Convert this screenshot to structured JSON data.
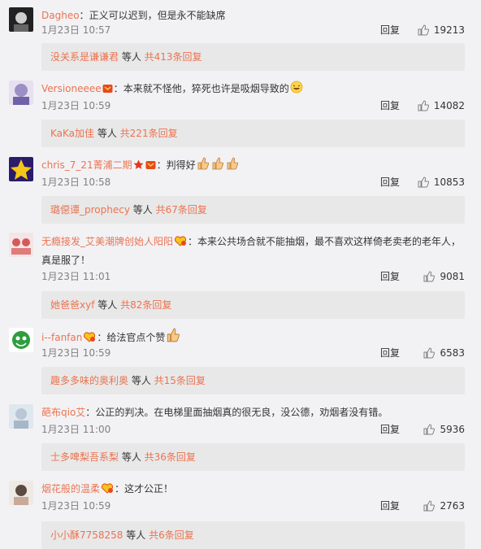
{
  "colors": {
    "accent": "#eb7350",
    "background": "#f2f2f5",
    "subreply_bg": "#e8e8e8"
  },
  "comments": [
    {
      "username": "Dagheo",
      "separator": "：",
      "text": "正义可以迟到，但是永不能缺席",
      "time": "1月23日 10:57",
      "reply_label": "回复",
      "likes": "19213",
      "subreply": {
        "names": "没关系是谦谦君",
        "mid": " 等人 ",
        "count": "共413条回复"
      }
    },
    {
      "username": "Versioneeee",
      "badges": [
        "vip-badge-icon"
      ],
      "separator": "：",
      "text": "本来就不怪他，猝死也许是吸烟导致的",
      "emoji": "laughing-emoji-icon",
      "time": "1月23日 10:59",
      "reply_label": "回复",
      "likes": "14082",
      "subreply": {
        "names": "KaKa加佳",
        "mid": " 等人 ",
        "count": "共221条回复"
      }
    },
    {
      "username": "chris_7_21菁浦二期",
      "badges": [
        "star-icon",
        "vip-badge-icon"
      ],
      "separator": "：",
      "text": "判得好",
      "emoji": "thumbs-up-icon",
      "time": "1月23日 10:58",
      "reply_label": "回复",
      "likes": "10853",
      "subreply": {
        "names": "璐僫谭_prophecy",
        "mid": " 等人 ",
        "count": "共67条回复"
      }
    },
    {
      "username": "无瘾接发_艾美潮牌创始人阳阳",
      "badges": [
        "fan-badge-icon"
      ],
      "separator": "：",
      "text": "本来公共场合就不能抽烟，最不喜欢这样倚老卖老的老年人，真是服了！",
      "time": "1月23日 11:01",
      "reply_label": "回复",
      "likes": "9081",
      "subreply": {
        "names": "她爸爸xyf",
        "mid": " 等人 ",
        "count": "共82条回复"
      }
    },
    {
      "username": "i--fanfan",
      "badges": [
        "fan-badge-icon"
      ],
      "separator": "：",
      "text": "给法官点个赞",
      "emoji": "thumbs-up-icon",
      "time": "1月23日 10:59",
      "reply_label": "回复",
      "likes": "6583",
      "subreply": {
        "names": "趣多多味的奥利奥",
        "mid": " 等人 ",
        "count": "共15条回复"
      }
    },
    {
      "username": "葩布qio艾",
      "separator": "：",
      "text": "公正的判决。在电梯里面抽烟真的很无良，没公德，劝烟者没有错。",
      "time": "1月23日 11:00",
      "reply_label": "回复",
      "likes": "5936",
      "subreply": {
        "names": "士多啤梨吾系梨",
        "mid": " 等人 ",
        "count": "共36条回复"
      }
    },
    {
      "username": "烟花般的温柔",
      "badges": [
        "fan-badge-icon"
      ],
      "separator": "：",
      "text": "这才公正！",
      "time": "1月23日 10:59",
      "reply_label": "回复",
      "likes": "2763",
      "subreply": {
        "names": "小小酥7758258",
        "mid": " 等人 ",
        "count": "共6条回复"
      }
    }
  ]
}
